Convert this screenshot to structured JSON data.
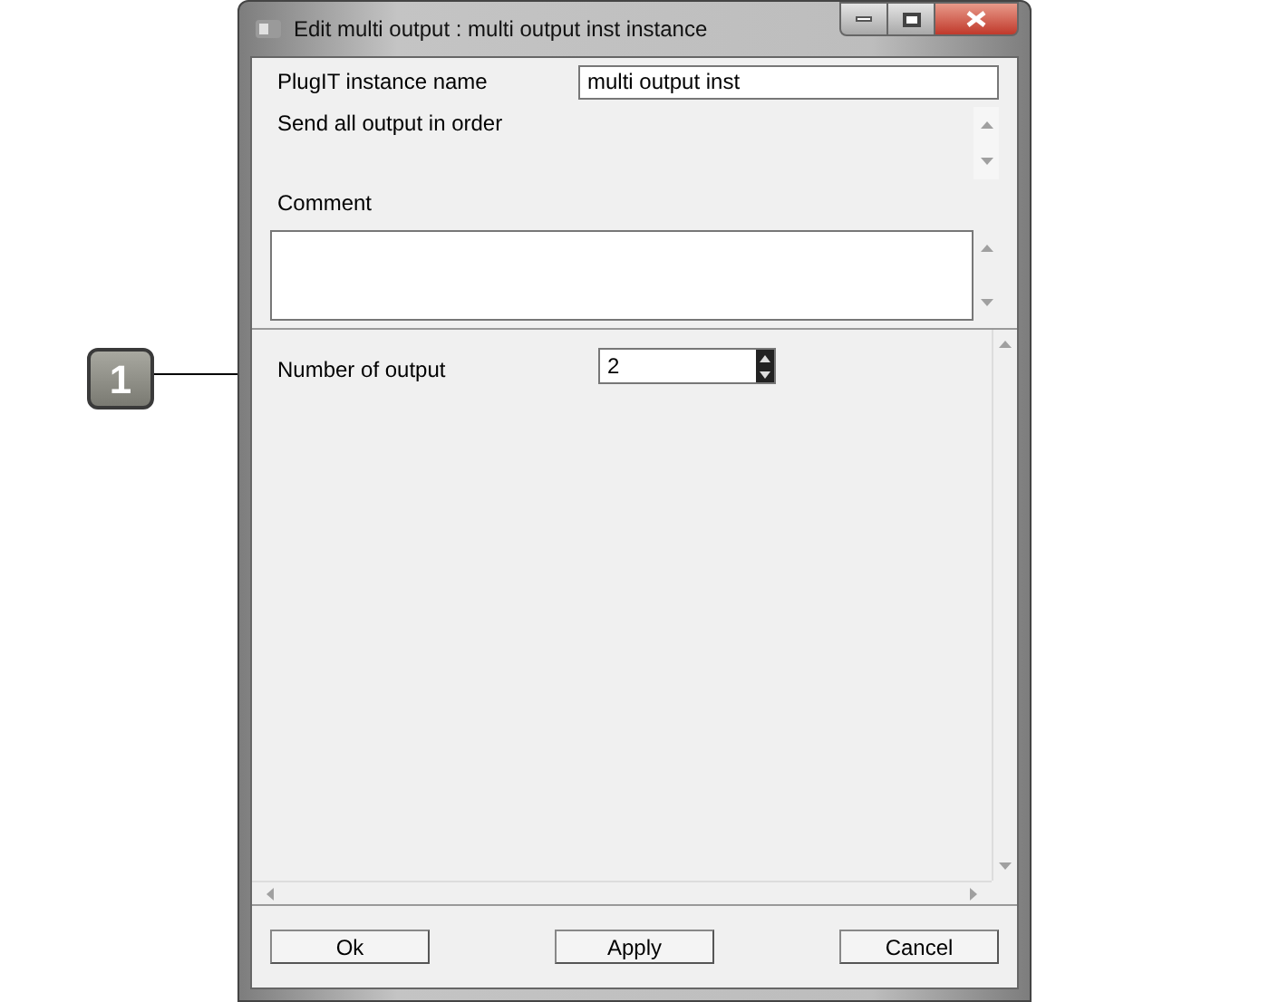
{
  "window": {
    "title": "Edit multi output : multi output inst instance"
  },
  "instance_name": {
    "label": "PlugIT instance name",
    "value": "multi output inst"
  },
  "description": "Send all output in order",
  "comment": {
    "label": "Comment"
  },
  "number_of_output": {
    "label": "Number of output",
    "value": "2"
  },
  "buttons": [
    "Ok",
    "Apply",
    "Cancel"
  ],
  "callout": {
    "label": "1"
  }
}
